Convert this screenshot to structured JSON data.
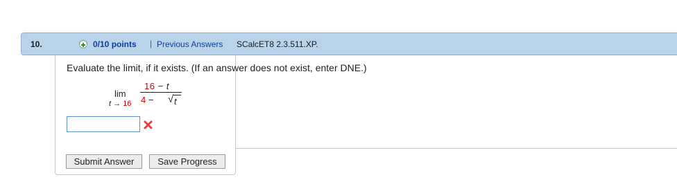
{
  "header": {
    "question_number": "10.",
    "points": "0/10 points",
    "separator": "|",
    "previous_answers": "Previous Answers",
    "problem_code": "SCalcET8 2.3.511.XP."
  },
  "question": {
    "prompt": "Evaluate the limit, if it exists. (If an answer does not exist, enter DNE.)",
    "limit": {
      "lim_word": "lim",
      "sub_var": "t",
      "sub_arrow": "→",
      "sub_value": "16",
      "numerator_const": "16",
      "numerator_op": "−",
      "numerator_var": "t",
      "denominator_const": "4",
      "denominator_op": "−",
      "radical": "√",
      "radicand": "t"
    }
  },
  "answer": {
    "value": "",
    "status_icon": "incorrect-x-icon",
    "status_color": "#e84040"
  },
  "buttons": {
    "submit": "Submit Answer",
    "save": "Save Progress"
  },
  "colors": {
    "header_bg": "#b9d4ea",
    "link": "#0a3e9e",
    "highlight": "#cc0000"
  }
}
